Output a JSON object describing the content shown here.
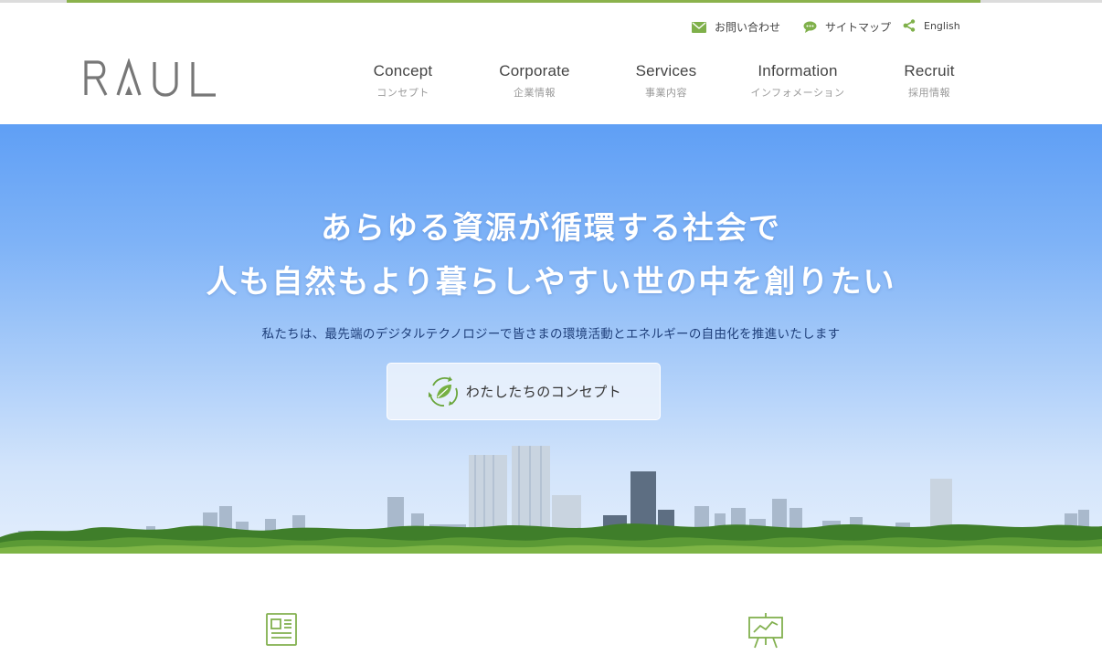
{
  "utility_links": {
    "contact": "お問い合わせ",
    "sitemap": "サイトマップ",
    "english": "English"
  },
  "logo": {
    "text": "RAUL"
  },
  "nav": [
    {
      "en": "Concept",
      "ja": "コンセプト"
    },
    {
      "en": "Corporate",
      "ja": "企業情報"
    },
    {
      "en": "Services",
      "ja": "事業内容"
    },
    {
      "en": "Information",
      "ja": "インフォメーション"
    },
    {
      "en": "Recruit",
      "ja": "採用情報"
    }
  ],
  "hero": {
    "headline_line1": "あらゆる資源が循環する社会で",
    "headline_line2": "人も自然もより暮らしやすい世の中を創りたい",
    "subtext": "私たちは、最先端のデジタルテクノロジーで皆さまの環境活動とエネルギーの自由化を推進いたします",
    "button_label": "わたしたちのコンセプト"
  },
  "colors": {
    "accent_green": "#8bb24c",
    "sky_top": "#5f9ff5",
    "sky_bottom": "#e3eefc",
    "subtext_navy": "#1f3f7a"
  },
  "icons": [
    "mail-icon",
    "chat-bubble-icon",
    "share-icon",
    "leaf-cycle-icon",
    "newspaper-icon",
    "presentation-chart-icon"
  ]
}
